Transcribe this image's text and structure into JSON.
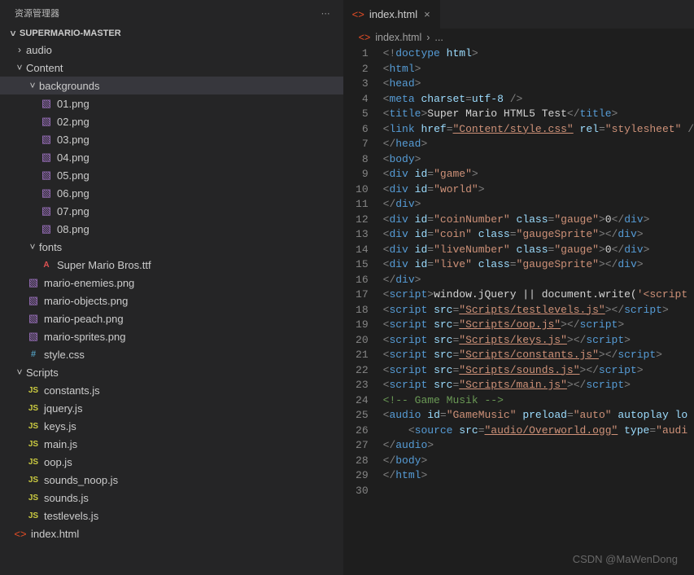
{
  "sidebar": {
    "title": "资源管理器",
    "project": "SUPERMARIO-MASTER",
    "tree": [
      {
        "depth": 1,
        "type": "folder",
        "open": false,
        "label": "audio"
      },
      {
        "depth": 1,
        "type": "folder",
        "open": true,
        "label": "Content"
      },
      {
        "depth": 2,
        "type": "folder",
        "open": true,
        "label": "backgrounds",
        "selected": true
      },
      {
        "depth": 3,
        "type": "img",
        "label": "01.png"
      },
      {
        "depth": 3,
        "type": "img",
        "label": "02.png"
      },
      {
        "depth": 3,
        "type": "img",
        "label": "03.png"
      },
      {
        "depth": 3,
        "type": "img",
        "label": "04.png"
      },
      {
        "depth": 3,
        "type": "img",
        "label": "05.png"
      },
      {
        "depth": 3,
        "type": "img",
        "label": "06.png"
      },
      {
        "depth": 3,
        "type": "img",
        "label": "07.png"
      },
      {
        "depth": 3,
        "type": "img",
        "label": "08.png"
      },
      {
        "depth": 2,
        "type": "folder",
        "open": true,
        "label": "fonts"
      },
      {
        "depth": 3,
        "type": "font",
        "label": "Super Mario Bros.ttf"
      },
      {
        "depth": 2,
        "type": "img",
        "label": "mario-enemies.png"
      },
      {
        "depth": 2,
        "type": "img",
        "label": "mario-objects.png"
      },
      {
        "depth": 2,
        "type": "img",
        "label": "mario-peach.png"
      },
      {
        "depth": 2,
        "type": "img",
        "label": "mario-sprites.png"
      },
      {
        "depth": 2,
        "type": "css",
        "label": "style.css"
      },
      {
        "depth": 1,
        "type": "folder",
        "open": true,
        "label": "Scripts"
      },
      {
        "depth": 2,
        "type": "js",
        "label": "constants.js"
      },
      {
        "depth": 2,
        "type": "js",
        "label": "jquery.js"
      },
      {
        "depth": 2,
        "type": "js",
        "label": "keys.js"
      },
      {
        "depth": 2,
        "type": "js",
        "label": "main.js"
      },
      {
        "depth": 2,
        "type": "js",
        "label": "oop.js"
      },
      {
        "depth": 2,
        "type": "js",
        "label": "sounds_noop.js"
      },
      {
        "depth": 2,
        "type": "js",
        "label": "sounds.js"
      },
      {
        "depth": 2,
        "type": "js",
        "label": "testlevels.js"
      },
      {
        "depth": 1,
        "type": "html",
        "label": "index.html"
      }
    ]
  },
  "editor": {
    "tab": {
      "label": "index.html"
    },
    "breadcrumb": {
      "file": "index.html",
      "more": "..."
    },
    "lines": [
      [
        {
          "c": "punc",
          "t": "<!"
        },
        {
          "c": "tag",
          "t": "doctype "
        },
        {
          "c": "attr",
          "t": "html"
        },
        {
          "c": "punc",
          "t": ">"
        }
      ],
      [
        {
          "c": "punc",
          "t": "<"
        },
        {
          "c": "tag",
          "t": "html"
        },
        {
          "c": "punc",
          "t": ">"
        }
      ],
      [
        {
          "c": "punc",
          "t": "<"
        },
        {
          "c": "tag",
          "t": "head"
        },
        {
          "c": "punc",
          "t": ">"
        }
      ],
      [
        {
          "c": "punc",
          "t": "<"
        },
        {
          "c": "tag",
          "t": "meta "
        },
        {
          "c": "attr",
          "t": "charset"
        },
        {
          "c": "punc",
          "t": "="
        },
        {
          "c": "attr",
          "t": "utf-8"
        },
        {
          "c": "punc",
          "t": " />"
        }
      ],
      [
        {
          "c": "punc",
          "t": "<"
        },
        {
          "c": "tag",
          "t": "title"
        },
        {
          "c": "punc",
          "t": ">"
        },
        {
          "c": "text",
          "t": "Super Mario HTML5 Test"
        },
        {
          "c": "punc",
          "t": "</"
        },
        {
          "c": "tag",
          "t": "title"
        },
        {
          "c": "punc",
          "t": ">"
        }
      ],
      [
        {
          "c": "punc",
          "t": "<"
        },
        {
          "c": "tag",
          "t": "link "
        },
        {
          "c": "attr",
          "t": "href"
        },
        {
          "c": "punc",
          "t": "="
        },
        {
          "c": "str-u",
          "t": "\"Content/style.css\""
        },
        {
          "c": "attr",
          "t": " rel"
        },
        {
          "c": "punc",
          "t": "="
        },
        {
          "c": "str",
          "t": "\"stylesheet\""
        },
        {
          "c": "punc",
          "t": " /"
        }
      ],
      [
        {
          "c": "punc",
          "t": "</"
        },
        {
          "c": "tag",
          "t": "head"
        },
        {
          "c": "punc",
          "t": ">"
        }
      ],
      [
        {
          "c": "punc",
          "t": "<"
        },
        {
          "c": "tag",
          "t": "body"
        },
        {
          "c": "punc",
          "t": ">"
        }
      ],
      [
        {
          "c": "punc",
          "t": "<"
        },
        {
          "c": "tag",
          "t": "div "
        },
        {
          "c": "attr",
          "t": "id"
        },
        {
          "c": "punc",
          "t": "="
        },
        {
          "c": "str",
          "t": "\"game\""
        },
        {
          "c": "punc",
          "t": ">"
        }
      ],
      [
        {
          "c": "punc",
          "t": "<"
        },
        {
          "c": "tag",
          "t": "div "
        },
        {
          "c": "attr",
          "t": "id"
        },
        {
          "c": "punc",
          "t": "="
        },
        {
          "c": "str",
          "t": "\"world\""
        },
        {
          "c": "punc",
          "t": ">"
        }
      ],
      [
        {
          "c": "punc",
          "t": "</"
        },
        {
          "c": "tag",
          "t": "div"
        },
        {
          "c": "punc",
          "t": ">"
        }
      ],
      [
        {
          "c": "punc",
          "t": "<"
        },
        {
          "c": "tag",
          "t": "div "
        },
        {
          "c": "attr",
          "t": "id"
        },
        {
          "c": "punc",
          "t": "="
        },
        {
          "c": "str",
          "t": "\"coinNumber\""
        },
        {
          "c": "attr",
          "t": " class"
        },
        {
          "c": "punc",
          "t": "="
        },
        {
          "c": "str",
          "t": "\"gauge\""
        },
        {
          "c": "punc",
          "t": ">"
        },
        {
          "c": "text",
          "t": "0"
        },
        {
          "c": "punc",
          "t": "</"
        },
        {
          "c": "tag",
          "t": "div"
        },
        {
          "c": "punc",
          "t": ">"
        }
      ],
      [
        {
          "c": "punc",
          "t": "<"
        },
        {
          "c": "tag",
          "t": "div "
        },
        {
          "c": "attr",
          "t": "id"
        },
        {
          "c": "punc",
          "t": "="
        },
        {
          "c": "str",
          "t": "\"coin\""
        },
        {
          "c": "attr",
          "t": " class"
        },
        {
          "c": "punc",
          "t": "="
        },
        {
          "c": "str",
          "t": "\"gaugeSprite\""
        },
        {
          "c": "punc",
          "t": "></"
        },
        {
          "c": "tag",
          "t": "div"
        },
        {
          "c": "punc",
          "t": ">"
        }
      ],
      [
        {
          "c": "punc",
          "t": "<"
        },
        {
          "c": "tag",
          "t": "div "
        },
        {
          "c": "attr",
          "t": "id"
        },
        {
          "c": "punc",
          "t": "="
        },
        {
          "c": "str",
          "t": "\"liveNumber\""
        },
        {
          "c": "attr",
          "t": " class"
        },
        {
          "c": "punc",
          "t": "="
        },
        {
          "c": "str",
          "t": "\"gauge\""
        },
        {
          "c": "punc",
          "t": ">"
        },
        {
          "c": "text",
          "t": "0"
        },
        {
          "c": "punc",
          "t": "</"
        },
        {
          "c": "tag",
          "t": "div"
        },
        {
          "c": "punc",
          "t": ">"
        }
      ],
      [
        {
          "c": "punc",
          "t": "<"
        },
        {
          "c": "tag",
          "t": "div "
        },
        {
          "c": "attr",
          "t": "id"
        },
        {
          "c": "punc",
          "t": "="
        },
        {
          "c": "str",
          "t": "\"live\""
        },
        {
          "c": "attr",
          "t": " class"
        },
        {
          "c": "punc",
          "t": "="
        },
        {
          "c": "str",
          "t": "\"gaugeSprite\""
        },
        {
          "c": "punc",
          "t": "></"
        },
        {
          "c": "tag",
          "t": "div"
        },
        {
          "c": "punc",
          "t": ">"
        }
      ],
      [
        {
          "c": "punc",
          "t": "</"
        },
        {
          "c": "tag",
          "t": "div"
        },
        {
          "c": "punc",
          "t": ">"
        }
      ],
      [
        {
          "c": "punc",
          "t": "<"
        },
        {
          "c": "tag",
          "t": "script"
        },
        {
          "c": "punc",
          "t": ">"
        },
        {
          "c": "text",
          "t": "window.jQuery || document.write("
        },
        {
          "c": "str",
          "t": "'<script "
        }
      ],
      [
        {
          "c": "punc",
          "t": "<"
        },
        {
          "c": "tag",
          "t": "script "
        },
        {
          "c": "attr",
          "t": "src"
        },
        {
          "c": "punc",
          "t": "="
        },
        {
          "c": "str-u",
          "t": "\"Scripts/testlevels.js\""
        },
        {
          "c": "punc",
          "t": "></"
        },
        {
          "c": "tag",
          "t": "script"
        },
        {
          "c": "punc",
          "t": ">"
        }
      ],
      [
        {
          "c": "punc",
          "t": "<"
        },
        {
          "c": "tag",
          "t": "script "
        },
        {
          "c": "attr",
          "t": "src"
        },
        {
          "c": "punc",
          "t": "="
        },
        {
          "c": "str-u",
          "t": "\"Scripts/oop.js\""
        },
        {
          "c": "punc",
          "t": "></"
        },
        {
          "c": "tag",
          "t": "script"
        },
        {
          "c": "punc",
          "t": ">"
        }
      ],
      [
        {
          "c": "punc",
          "t": "<"
        },
        {
          "c": "tag",
          "t": "script "
        },
        {
          "c": "attr",
          "t": "src"
        },
        {
          "c": "punc",
          "t": "="
        },
        {
          "c": "str-u",
          "t": "\"Scripts/keys.js\""
        },
        {
          "c": "punc",
          "t": "></"
        },
        {
          "c": "tag",
          "t": "script"
        },
        {
          "c": "punc",
          "t": ">"
        }
      ],
      [
        {
          "c": "punc",
          "t": "<"
        },
        {
          "c": "tag",
          "t": "script "
        },
        {
          "c": "attr",
          "t": "src"
        },
        {
          "c": "punc",
          "t": "="
        },
        {
          "c": "str-u",
          "t": "\"Scripts/constants.js\""
        },
        {
          "c": "punc",
          "t": "></"
        },
        {
          "c": "tag",
          "t": "script"
        },
        {
          "c": "punc",
          "t": ">"
        }
      ],
      [
        {
          "c": "punc",
          "t": "<"
        },
        {
          "c": "tag",
          "t": "script "
        },
        {
          "c": "attr",
          "t": "src"
        },
        {
          "c": "punc",
          "t": "="
        },
        {
          "c": "str-u",
          "t": "\"Scripts/sounds.js\""
        },
        {
          "c": "punc",
          "t": "></"
        },
        {
          "c": "tag",
          "t": "script"
        },
        {
          "c": "punc",
          "t": ">"
        }
      ],
      [
        {
          "c": "punc",
          "t": "<"
        },
        {
          "c": "tag",
          "t": "script "
        },
        {
          "c": "attr",
          "t": "src"
        },
        {
          "c": "punc",
          "t": "="
        },
        {
          "c": "str-u",
          "t": "\"Scripts/main.js\""
        },
        {
          "c": "punc",
          "t": "></"
        },
        {
          "c": "tag",
          "t": "script"
        },
        {
          "c": "punc",
          "t": ">"
        }
      ],
      [
        {
          "c": "comment",
          "t": "<!-- Game Musik -->"
        }
      ],
      [
        {
          "c": "punc",
          "t": "<"
        },
        {
          "c": "tag",
          "t": "audio "
        },
        {
          "c": "attr",
          "t": "id"
        },
        {
          "c": "punc",
          "t": "="
        },
        {
          "c": "str",
          "t": "\"GameMusic\""
        },
        {
          "c": "attr",
          "t": " preload"
        },
        {
          "c": "punc",
          "t": "="
        },
        {
          "c": "str",
          "t": "\"auto\""
        },
        {
          "c": "attr",
          "t": " autoplay lo"
        }
      ],
      [
        {
          "c": "text",
          "t": "    "
        },
        {
          "c": "punc",
          "t": "<"
        },
        {
          "c": "tag",
          "t": "source "
        },
        {
          "c": "attr",
          "t": "src"
        },
        {
          "c": "punc",
          "t": "="
        },
        {
          "c": "str-u",
          "t": "\"audio/Overworld.ogg\""
        },
        {
          "c": "attr",
          "t": " type"
        },
        {
          "c": "punc",
          "t": "="
        },
        {
          "c": "str",
          "t": "\"audi"
        }
      ],
      [
        {
          "c": "punc",
          "t": "</"
        },
        {
          "c": "tag",
          "t": "audio"
        },
        {
          "c": "punc",
          "t": ">"
        }
      ],
      [
        {
          "c": "punc",
          "t": "</"
        },
        {
          "c": "tag",
          "t": "body"
        },
        {
          "c": "punc",
          "t": ">"
        }
      ],
      [
        {
          "c": "punc",
          "t": "</"
        },
        {
          "c": "tag",
          "t": "html"
        },
        {
          "c": "punc",
          "t": ">"
        }
      ],
      [
        {
          "c": "text",
          "t": ""
        }
      ]
    ]
  },
  "watermark": "CSDN @MaWenDong"
}
